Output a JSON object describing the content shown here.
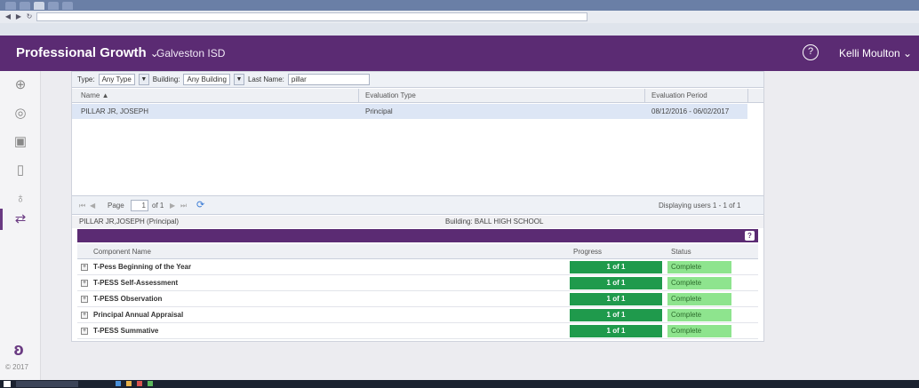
{
  "app": {
    "name": "Professional Growth",
    "name_caret": "⌄",
    "district": "Galveston ISD",
    "user": "Kelli Moulton ⌄",
    "help_glyph": "?"
  },
  "rail": {
    "copyright": "© 2017"
  },
  "filters": {
    "type_label": "Type:",
    "type_value": "Any Type",
    "building_label": "Building:",
    "building_value": "Any Building",
    "last_name_label": "Last Name:",
    "last_name_value": "pillar"
  },
  "grid": {
    "columns": [
      "Name ▲",
      "Evaluation Type",
      "Evaluation Period"
    ],
    "rows": [
      {
        "name": "PILLAR JR, JOSEPH",
        "evaluation_type": "Principal",
        "evaluation_period": "08/12/2016 - 06/02/2017"
      }
    ]
  },
  "pager": {
    "page_label": "Page",
    "page_value": "1",
    "of_label": "of 1",
    "display_text": "Displaying users 1 - 1 of 1"
  },
  "selected": {
    "person": "PILLAR JR,JOSEPH (Principal)",
    "building": "Building: BALL HIGH SCHOOL"
  },
  "components": {
    "columns": [
      "Component Name",
      "Progress",
      "Status"
    ],
    "rows": [
      {
        "name": "T-Pess Beginning of the Year",
        "progress": "1 of 1",
        "status": "Complete"
      },
      {
        "name": "T-PESS Self-Assessment",
        "progress": "1 of 1",
        "status": "Complete"
      },
      {
        "name": "T-PESS Observation",
        "progress": "1 of 1",
        "status": "Complete"
      },
      {
        "name": "Principal Annual Appraisal",
        "progress": "1 of 1",
        "status": "Complete"
      },
      {
        "name": "T-PESS Summative",
        "progress": "1 of 1",
        "status": "Complete"
      }
    ]
  },
  "colors": {
    "brand_purple": "#5b2b73",
    "progress_green": "#1f9a4c",
    "status_green": "#8ee48e",
    "selected_row": "#dde6f5"
  },
  "icons": {
    "rail": [
      "arrow-circle-right-icon",
      "badge-icon",
      "contacts-icon",
      "clipboard-icon",
      "goals-icon",
      "swap-arrows-icon"
    ],
    "help": "help-circle-icon",
    "refresh": "refresh-icon",
    "question": "question-icon"
  }
}
